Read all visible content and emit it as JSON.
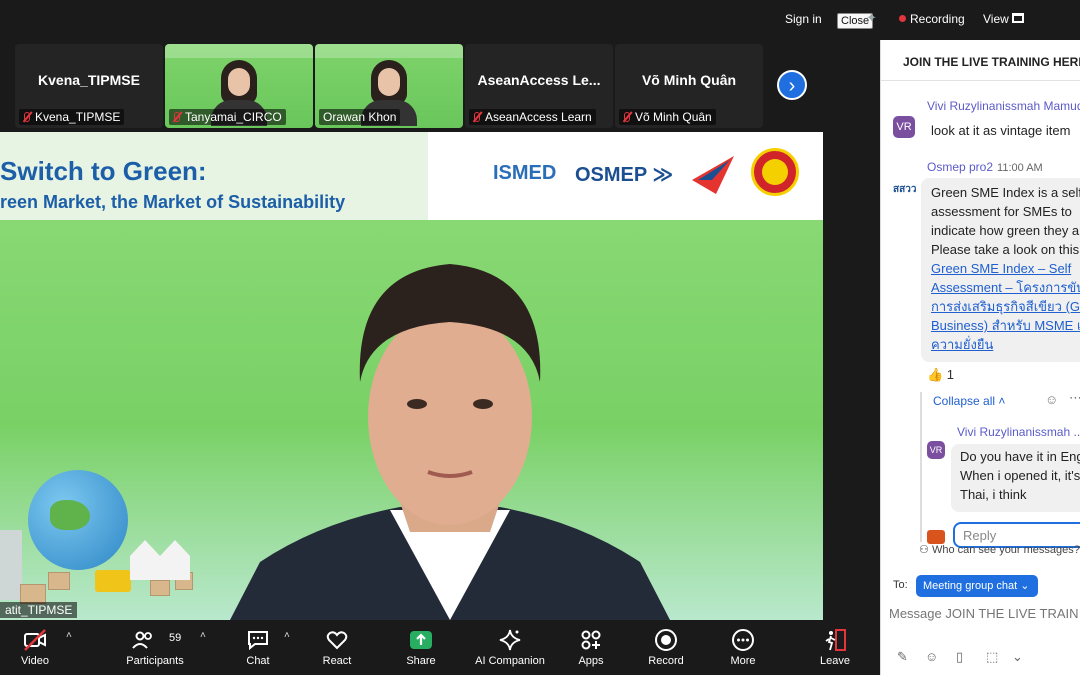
{
  "topbar": {
    "sign_in": "Sign in",
    "close_tip": "Close",
    "recording": "Recording",
    "view": "View"
  },
  "thumbnails": [
    {
      "name": "Kvena_TIPMSE",
      "label": "Kvena_TIPMSE",
      "video": false
    },
    {
      "name": "",
      "label": "Tanyamai_CIRCO",
      "video": true
    },
    {
      "name": "",
      "label": "Orawan Khon",
      "video": true
    },
    {
      "name": "AseanAccess Le...",
      "label": "AseanAccess Learn",
      "video": false
    },
    {
      "name": "Võ Minh Quân",
      "label": "Võ Minh Quân",
      "video": false
    }
  ],
  "slide": {
    "title": "Switch to Green:",
    "subtitle": "reen Market, the Market of Sustainability",
    "logo_ismed": "ISMED",
    "logo_osmep": "OSMEP",
    "speaker_label": "atit_TIPMSE"
  },
  "chat": {
    "title": "JOIN THE LIVE TRAINING HERE",
    "msg1": {
      "avatar": "VR",
      "sender": "Vivi Ruzylinanissmah Mamuda",
      "text": "look at it as vintage item"
    },
    "msg2": {
      "avatar": "สสวว",
      "sender": "Osmep pro2",
      "time": "11:00 AM",
      "lines": [
        "Green SME Index is a self-",
        "assessment for SMEs to",
        "indicate how green they are.",
        "Please take a look on this."
      ],
      "link_lines": [
        "Green SME Index – Self",
        "Assessment – โครงการขับ",
        "การส่งเสริมธุรกิจสีเขียว (Green",
        "Business) สำหรับ MSME เพื่อ",
        "ความยั่งยืน"
      ]
    },
    "reaction": "👍 1",
    "collapse": "Collapse all",
    "msg3": {
      "avatar": "VR",
      "sender": "Vivi Ruzylinanissmah ...",
      "lines": [
        "Do you have it in English?",
        "When i opened it, it's in",
        "Thai, i think"
      ]
    },
    "reply_placeholder": "Reply",
    "who_can_see": "Who can see your messages?",
    "to_label": "To:",
    "to_value": "Meeting group chat",
    "input_placeholder": "Message JOIN THE LIVE TRAINING HERE"
  },
  "toolbar": {
    "video": "Video",
    "participants": "Participants",
    "participants_count": "59",
    "chat": "Chat",
    "react": "React",
    "share": "Share",
    "ai_companion": "AI Companion",
    "apps": "Apps",
    "record": "Record",
    "more": "More",
    "leave": "Leave"
  },
  "colors": {
    "accent": "#1f6fe0",
    "share_green": "#27ae60",
    "leave_red": "#e0363c",
    "chat_sender": "#5b5bc9"
  }
}
